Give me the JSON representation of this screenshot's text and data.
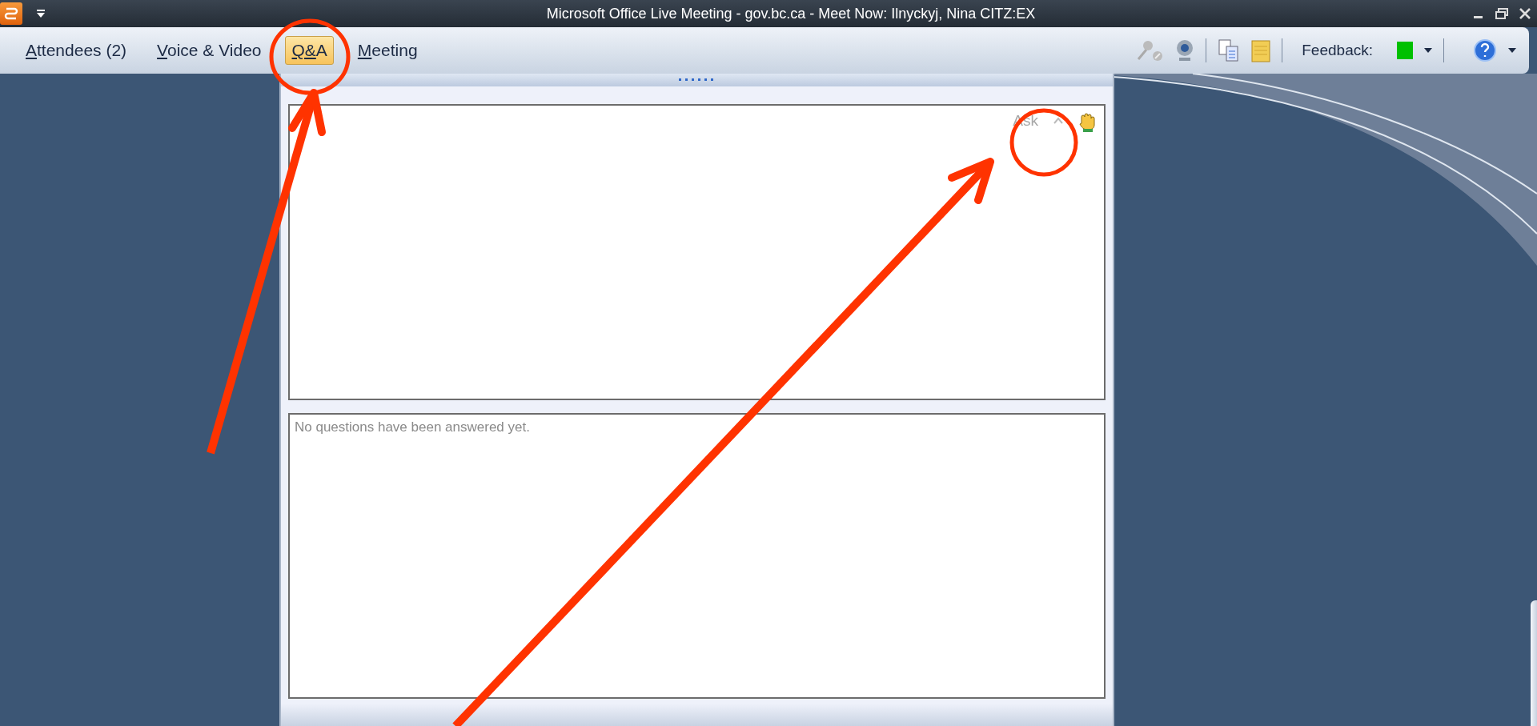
{
  "window": {
    "title": "Microsoft Office Live Meeting - gov.bc.ca - Meet Now: Ilnyckyj, Nina CITZ:EX"
  },
  "menu": [
    {
      "label": "Attendees (2)",
      "selected": false
    },
    {
      "label": "Voice & Video",
      "selected": false
    },
    {
      "label": "Q&A",
      "selected": true
    },
    {
      "label": "Meeting",
      "selected": false
    }
  ],
  "toolbar": {
    "feedback": {
      "label": "Feedback:",
      "color": "#00c000"
    }
  },
  "qa_panel": {
    "ask": {
      "label": "Ask",
      "disabled": true
    },
    "answered": {
      "message": "No questions have been answered yet."
    }
  }
}
